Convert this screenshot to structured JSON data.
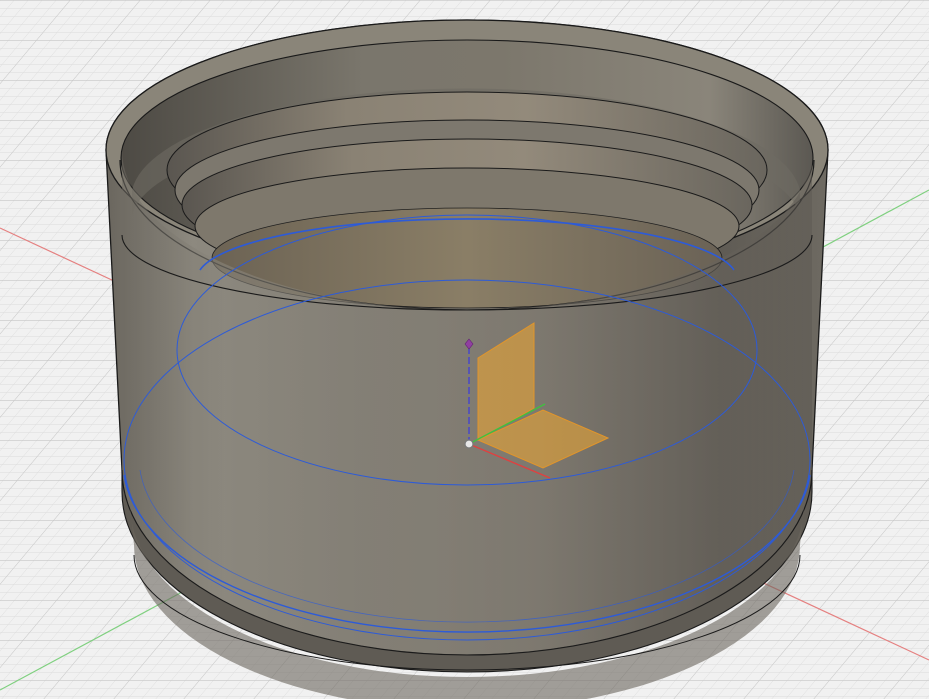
{
  "viewport": {
    "kind": "3d-cad-viewport",
    "background_color": "#f1f1f1",
    "grid_minor_color": "#d9d9d9",
    "grid_major_color": "#c4c4c4",
    "x_axis_color": "#e06060",
    "y_axis_color": "#6cc86c",
    "z_axis_color": "#3a3adf"
  },
  "model": {
    "type": "cylindrical cap with internal steps",
    "body_color": "#7b776d",
    "outline_color": "#202020",
    "sketch_profile_color": "#2d5bd8"
  },
  "origin": {
    "icon": "origin-axes-icon",
    "plane_color": "#f0a830",
    "point_color": "#9a9a9a"
  }
}
